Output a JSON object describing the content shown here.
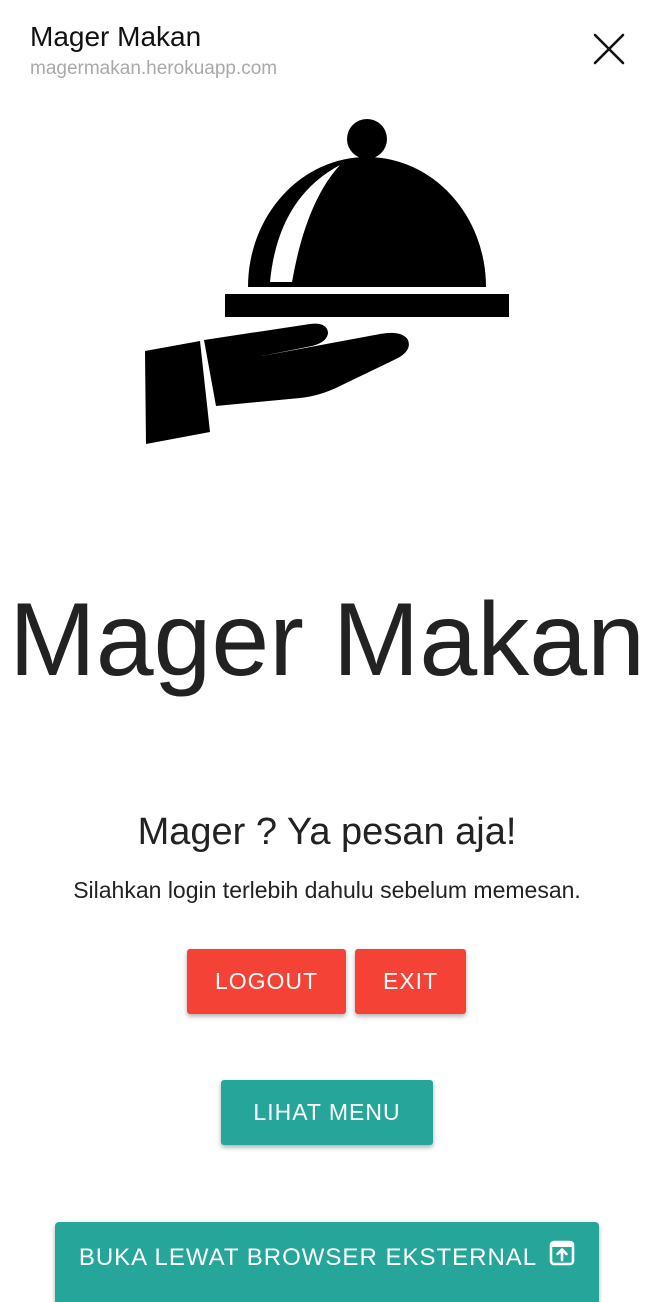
{
  "header": {
    "title": "Mager Makan",
    "url": "magermakan.herokuapp.com",
    "close_icon": "close-icon"
  },
  "logo": {
    "icon": "food-serving-cloche-hand-icon",
    "color": "#000000"
  },
  "main": {
    "headline": "Mager Makan",
    "tagline": "Mager ? Ya pesan aja!",
    "subtext": "Silahkan login terlebih dahulu sebelum memesan."
  },
  "buttons": {
    "logout": "LOGOUT",
    "exit": "EXIT",
    "menu": "LIHAT MENU",
    "external": "BUKA LEWAT BROWSER EKSTERNAL",
    "external_icon": "open-external-icon"
  },
  "colors": {
    "red": "#f44336",
    "teal": "#26a69a",
    "url_gray": "#a9a9a9",
    "text": "#222222"
  }
}
